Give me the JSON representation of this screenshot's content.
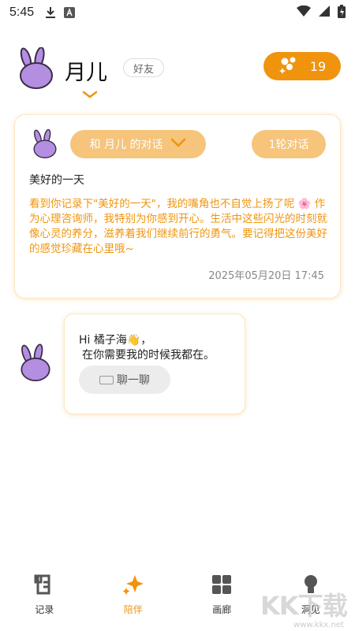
{
  "status_bar": {
    "time": "5:45"
  },
  "header": {
    "name": "月儿",
    "friend_tag": "好友",
    "points": "19"
  },
  "journal_card": {
    "conversation_label": "和 月儿 的对话",
    "rounds_label": "1轮对话",
    "title": "美好的一天",
    "body": "看到你记录下\"美好的一天\"，我的嘴角也不自觉上扬了呢 🌸 作为心理咨询师，我特别为你感到开心。生活中这些闪光的时刻就像心灵的养分，滋养着我们继续前行的勇气。要记得把这份美好的感觉珍藏在心里哦~",
    "date": "2025年05月20日 17:45"
  },
  "chat_bubble": {
    "greeting_line1": "Hi 橘子海👋，",
    "greeting_line2": "在你需要我的时候我都在。",
    "chat_button": "聊一聊"
  },
  "bottom_nav": [
    {
      "label": "记录",
      "icon": "journal-icon",
      "active": false
    },
    {
      "label": "陪伴",
      "icon": "sparkle-icon",
      "active": true
    },
    {
      "label": "画廊",
      "icon": "gallery-icon",
      "active": false
    },
    {
      "label": "洞见",
      "icon": "lightbulb-icon",
      "active": false
    }
  ],
  "watermark": {
    "text": "KK下载",
    "url": "www.kkx.net"
  },
  "colors": {
    "accent": "#f0940e",
    "pill": "#f6c47b",
    "avatar": "#b48ee0"
  }
}
